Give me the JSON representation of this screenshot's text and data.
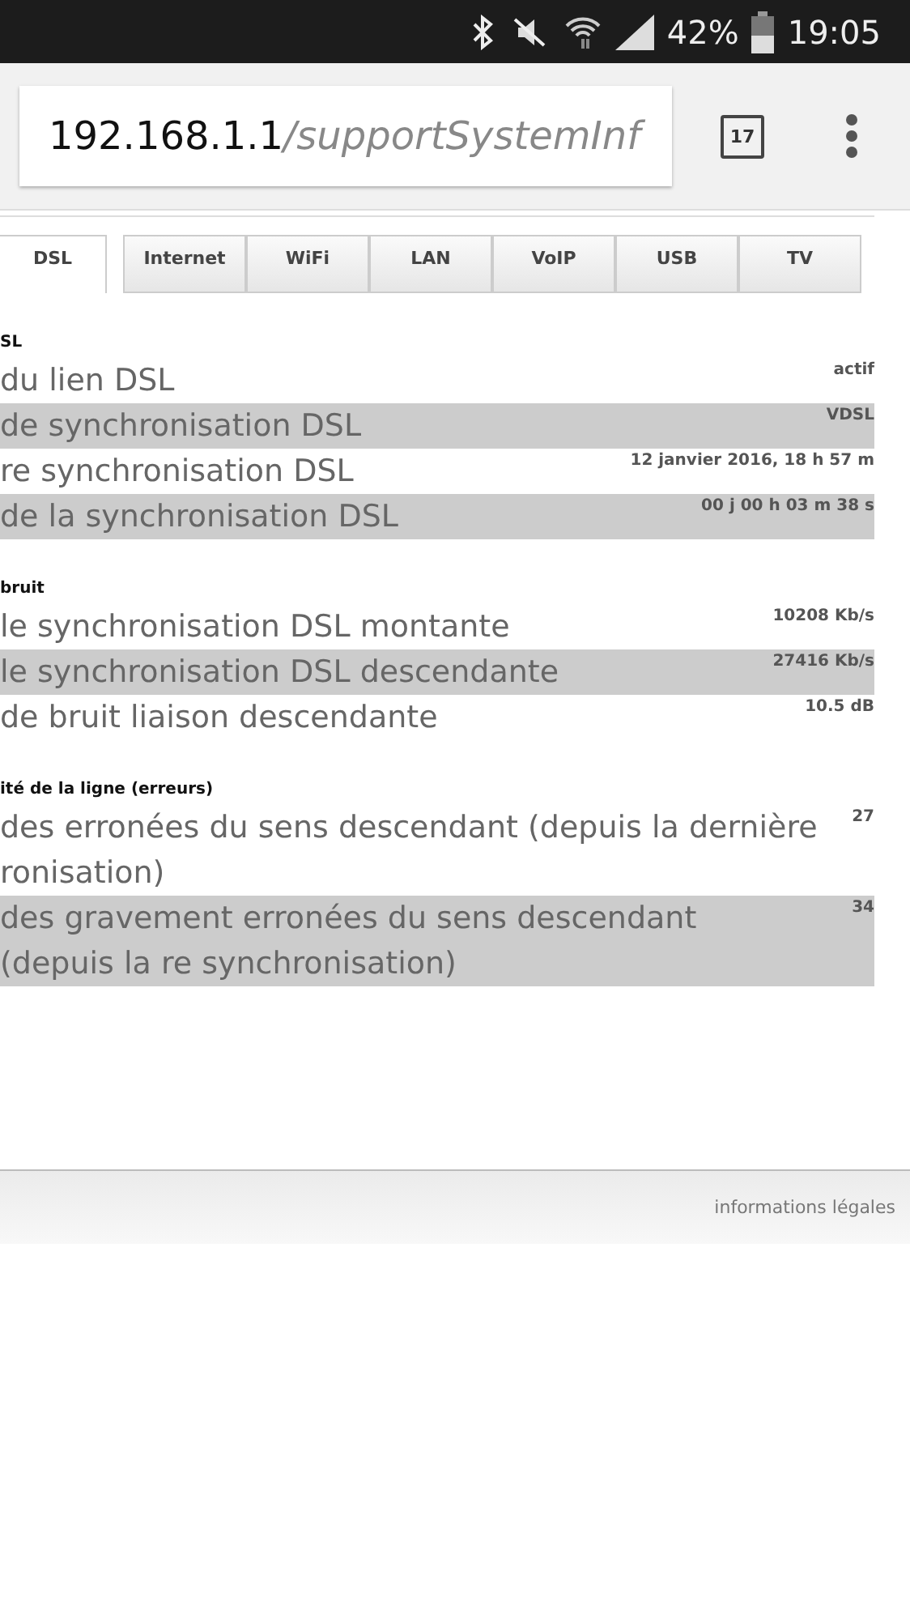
{
  "status_bar": {
    "battery_text": "42%",
    "time": "19:05"
  },
  "address_bar": {
    "host": "192.168.1.1",
    "path": "/supportSystemInf",
    "tab_count": "17"
  },
  "tabs": [
    {
      "label": "DSL",
      "selected": true
    },
    {
      "label": "Internet",
      "selected": false
    },
    {
      "label": "WiFi",
      "selected": false
    },
    {
      "label": "LAN",
      "selected": false
    },
    {
      "label": "VoIP",
      "selected": false
    },
    {
      "label": "USB",
      "selected": false
    },
    {
      "label": "TV",
      "selected": false
    }
  ],
  "sections": [
    {
      "heading": "SL",
      "rows": [
        {
          "label": "du lien DSL",
          "value": "actif"
        },
        {
          "label": "de synchronisation DSL",
          "value": "VDSL"
        },
        {
          "label": "re synchronisation DSL",
          "value": "12 janvier 2016, 18 h 57 m"
        },
        {
          "label": "de la synchronisation DSL",
          "value": "00 j 00 h 03 m 38 s"
        }
      ]
    },
    {
      "heading": "bruit",
      "rows": [
        {
          "label": "le synchronisation DSL montante",
          "value": "10208 Kb/s"
        },
        {
          "label": "le synchronisation DSL descendante",
          "value": "27416 Kb/s"
        },
        {
          "label": "de bruit liaison descendante",
          "value": "10.5 dB"
        }
      ]
    },
    {
      "heading": "ité de la ligne (erreurs)",
      "rows": [
        {
          "label": "des erronées du sens descendant (depuis la dernière ronisation)",
          "value": "27"
        },
        {
          "label": "des gravement erronées du sens descendant (depuis la re synchronisation)",
          "value": "34"
        }
      ]
    }
  ],
  "footer": {
    "link": "informations légales"
  }
}
